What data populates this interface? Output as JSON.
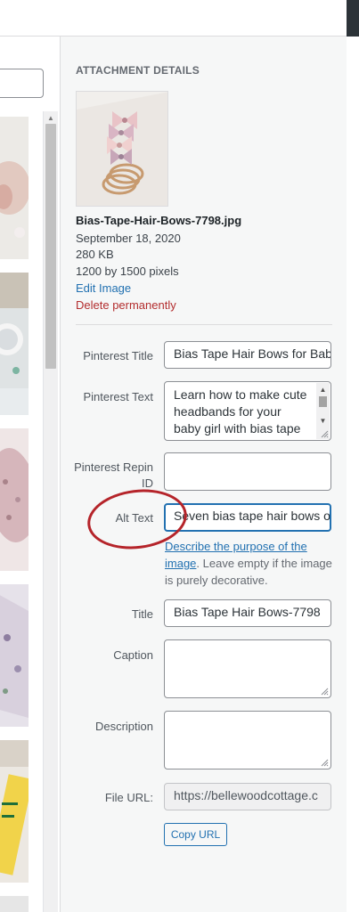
{
  "sidebar": {
    "heading": "ATTACHMENT DETAILS",
    "file": {
      "name": "Bias-Tape-Hair-Bows-7798.jpg",
      "date": "September 18, 2020",
      "size": "280 KB",
      "dimensions": "1200 by 1500 pixels",
      "edit_link": "Edit Image",
      "delete_link": "Delete permanently"
    },
    "fields": {
      "pinterest_title": {
        "label": "Pinterest Title",
        "value": "Bias Tape Hair Bows for Bab"
      },
      "pinterest_text": {
        "label": "Pinterest Text",
        "value": "Learn how to make cute headbands for your baby girl with bias tape"
      },
      "pinterest_repin": {
        "label": "Pinterest Repin ID",
        "value": ""
      },
      "alt_text": {
        "label": "Alt Text",
        "value": "Seven bias tape hair bows o"
      },
      "alt_help_link": "Describe the purpose of the image",
      "alt_help_text": ". Leave empty if the image is purely decorative.",
      "title": {
        "label": "Title",
        "value": "Bias Tape Hair Bows-7798"
      },
      "caption": {
        "label": "Caption",
        "value": ""
      },
      "description": {
        "label": "Description",
        "value": ""
      },
      "file_url": {
        "label": "File URL:",
        "value": "https://bellewoodcottage.c"
      }
    },
    "copy_button": "Copy URL"
  },
  "colors": {
    "link": "#2271b1",
    "danger": "#b32d2e",
    "annotation": "#b5242a",
    "sidebar_bg": "#f6f7f7"
  }
}
